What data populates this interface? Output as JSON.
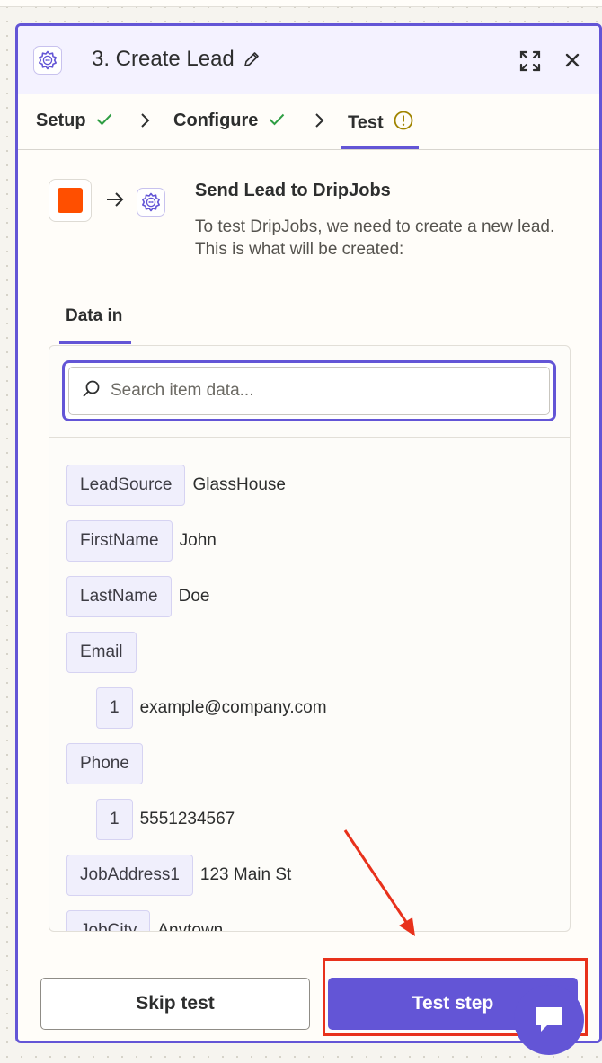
{
  "header": {
    "title": "3. Create Lead",
    "icons": [
      "app-logo-icon",
      "pencil-icon",
      "expand-icon",
      "close-icon"
    ]
  },
  "tabs": [
    {
      "label": "Setup",
      "status": "check-icon"
    },
    {
      "label": "Configure",
      "status": "check-icon"
    },
    {
      "label": "Test",
      "status": "warning-icon"
    }
  ],
  "intro": {
    "title": "Send Lead to DripJobs",
    "description": "To test DripJobs, we need to create a new lead. This is what will be created:"
  },
  "data_in": {
    "tab_label": "Data in",
    "search_placeholder": "Search item data...",
    "fields": [
      {
        "key": "LeadSource",
        "value": "GlassHouse"
      },
      {
        "key": "FirstName",
        "value": "John"
      },
      {
        "key": "LastName",
        "value": "Doe"
      },
      {
        "key": "Email",
        "value": ""
      },
      {
        "key": "1",
        "value": "example@company.com"
      },
      {
        "key": "Phone",
        "value": ""
      },
      {
        "key": "1",
        "value": "5551234567"
      },
      {
        "key": "JobAddress1",
        "value": "123 Main St"
      },
      {
        "key": "JobCity",
        "value": "Anytown"
      }
    ]
  },
  "footer": {
    "skip_label": "Skip test",
    "test_label": "Test step"
  },
  "colors": {
    "accent": "#6355d6",
    "orange": "#ff4f00",
    "success": "#2f9e44",
    "warning": "#a08400",
    "annotation": "#e8311b"
  }
}
